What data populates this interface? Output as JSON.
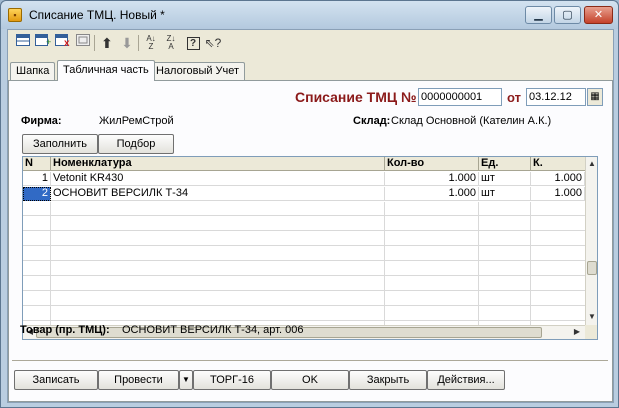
{
  "window": {
    "title": "Списание ТМЦ. Новый *",
    "icon": "document-icon",
    "controls": [
      "minimize-icon",
      "maximize-icon",
      "close-icon"
    ]
  },
  "toolbar": {
    "icons": [
      "new-row-icon",
      "copy-row-icon",
      "delete-row-icon",
      "edit-row-icon",
      "move-up-icon",
      "move-down-icon",
      "sort-asc-icon",
      "sort-desc-icon",
      "help-icon",
      "pointer-help-icon"
    ]
  },
  "tabs": [
    {
      "label": "Шапка"
    },
    {
      "label": "Табличная часть"
    },
    {
      "label": "Налоговый Учет"
    }
  ],
  "header": {
    "doc_title": "Списание ТМЦ №",
    "doc_number": "0000000001",
    "ot_label": "от",
    "doc_date": "03.12.12",
    "firm_label": "Фирма:",
    "firm_value": "ЖилРемСтрой",
    "warehouse_label": "Склад:",
    "warehouse_value": "Склад Основной (Кателин А.К.)"
  },
  "actions": {
    "fill": "Заполнить",
    "select": "Подбор"
  },
  "grid": {
    "columns": [
      "N",
      "Номенклатура",
      "Кол-во",
      "Ед.",
      "К."
    ],
    "rows": [
      {
        "n": "1",
        "name": "Vetonit KR430",
        "qty": "1.000",
        "unit": "шт",
        "k": "1.000"
      },
      {
        "n": "2",
        "name": "ОСНОВИТ ВЕРСИЛК Т-34",
        "qty": "1.000",
        "unit": "шт",
        "k": "1.000"
      }
    ]
  },
  "footer_info": {
    "label": "Товар (пр. ТМЦ):",
    "value": "ОСНОВИТ ВЕРСИЛК Т-34, арт. 006"
  },
  "buttons": {
    "save": "Записать",
    "post": "Провести",
    "torg": "ТОРГ-16",
    "ok": "OK",
    "close": "Закрыть",
    "actions": "Действия..."
  },
  "colors": {
    "accent_red": "#8b1a1a",
    "selection": "#316ac5"
  }
}
